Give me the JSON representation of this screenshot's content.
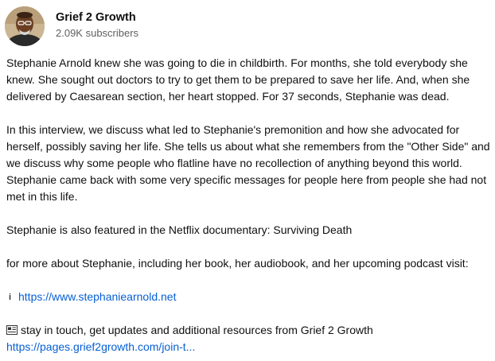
{
  "channel": {
    "name": "Grief 2 Growth",
    "subscribers": "2.09K subscribers"
  },
  "description": {
    "paragraph1": [
      "Stephanie Arnold knew she was going to die in childbirth. For months, she told everybody she",
      "knew. She sought out doctors to try to get them to be prepared to save her life. And, when she",
      "delivered by Caesarean section, her heart stopped. For 37 seconds, Stephanie was dead."
    ],
    "paragraph2": [
      "In this interview, we discuss what led to Stephanie's premonition and how she advocated for",
      "herself, possibly saving her life. She tells us about what she remembers from the \"Other Side\" and",
      "we discuss why some people who flatline have no recollection of anything beyond this world.",
      "Stephanie came back with some very specific messages for people here from people she had not",
      "met in this life."
    ],
    "paragraph3": "Stephanie is also featured in the Netflix documentary: Surviving Death",
    "paragraph4": "for more about Stephanie, including her book, her audiobook, and her upcoming podcast visit:",
    "info_icon": "i",
    "link1": "https://www.stephaniearnold.net",
    "newsletter_text": "stay in touch, get updates and additional resources from Grief 2 Growth",
    "link2": "https://pages.grief2growth.com/join-t..."
  },
  "icons": {
    "info": "info-icon",
    "newsletter": "newspaper-icon"
  },
  "colors": {
    "link": "#065fd4",
    "text": "#0f0f0f",
    "secondary": "#606060"
  }
}
